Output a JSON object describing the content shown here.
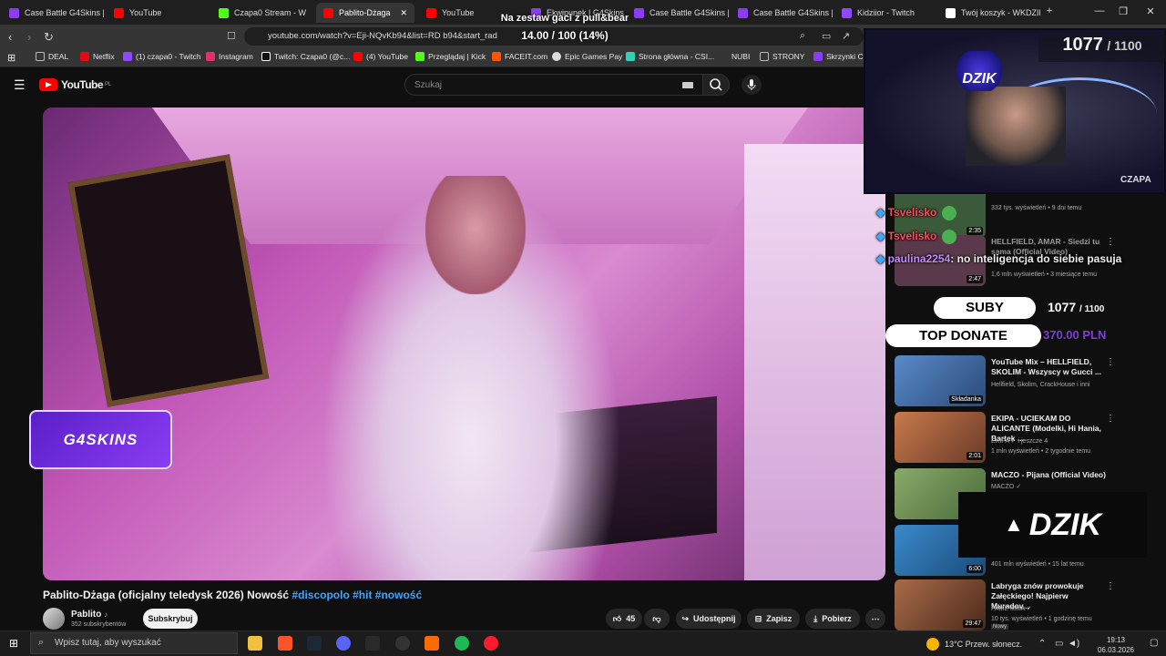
{
  "tabs": [
    {
      "label": "Case Battle G4Skins | 2",
      "color": "#8a3df2"
    },
    {
      "label": "YouTube",
      "color": "#ff0000"
    },
    {
      "label": "Czapa0 Stream - W",
      "color": "#53fc18"
    },
    {
      "label": "Pablito-Dżaga",
      "color": "#ff0000",
      "active": true
    },
    {
      "label": "YouTube",
      "color": "#ff0000"
    },
    {
      "label": "Ekwipunek | G4Skins",
      "color": "#8a3df2"
    },
    {
      "label": "Case Battle G4Skins | 2",
      "color": "#8a3df2"
    },
    {
      "label": "Case Battle G4Skins | 2",
      "color": "#8a3df2"
    },
    {
      "label": "Kidziior - Twitch",
      "color": "#9146ff"
    },
    {
      "label": "Twój koszyk - WKDZIK",
      "color": "#ffffff"
    }
  ],
  "address": {
    "url": "youtube.com/watch?v=Eji-NQvKb94&list=RD          b94&start_rad"
  },
  "bookmarks": [
    {
      "label": "DEAL",
      "color": "#bbbbbb"
    },
    {
      "label": "Netflix",
      "color": "#e50914"
    },
    {
      "label": "(1) czapa0 - Twitch",
      "color": "#9146ff"
    },
    {
      "label": "Instagram",
      "color": "#e1306c"
    },
    {
      "label": "Twitch: Czapa0 (@c...",
      "color": "#ffffff"
    },
    {
      "label": "(4) YouTube",
      "color": "#ff0000"
    },
    {
      "label": "Przeglądaj | Kick",
      "color": "#53fc18"
    },
    {
      "label": "FACEIT.com",
      "color": "#ff5500"
    },
    {
      "label": "Epic Games Pay",
      "color": "#dddddd"
    },
    {
      "label": "Strona główna - CSI...",
      "color": "#2ed3b7"
    },
    {
      "label": "NUBI",
      "color": "#888888"
    },
    {
      "label": "STRONY",
      "color": "#bbbbbb"
    },
    {
      "label": "Skrzynki CSs",
      "color": "#8a3df2"
    }
  ],
  "youtube": {
    "logo_text": "YouTube",
    "region": "PL",
    "search_placeholder": "Szukaj",
    "video_title": "Pablito-Dżaga (oficjalny teledysk 2026) Nowość",
    "video_tags": "#discopolo #hit #nowość",
    "channel_name": "Pablito",
    "channel_subs": "352 subskrybentów",
    "subscribe_label": "Subskrybuj",
    "likes": "45",
    "share_label": "Udostępnij",
    "save_label": "Zapisz",
    "download_label": "Pobierz"
  },
  "recommendations": [
    {
      "title": "",
      "meta1": "332 tys. wyświetleń • 9 dni temu",
      "meta2": "",
      "duration": "2:35",
      "color": "#3a5a3a"
    },
    {
      "title": "HELLFIELD, AMAR - Siedzi tu sama (Official Video)",
      "meta1": "1,6 mln wyświetleń • 3 miesiące temu",
      "meta2": "",
      "duration": "2:47",
      "color": "#5a3a4a"
    },
    {
      "title": "YouTube Mix – HELLFIELD, SKOLIM - Wszyscy w Gucci ...",
      "meta1": "Hellfield, Skolim, CrackHouse i inni",
      "meta2": "",
      "duration": "Składanka",
      "color": "#4a7ab0"
    },
    {
      "title": "EKIPA - UCIEKAM DO ALICANTE (Modelki, Hi Hania, Bartek ...",
      "meta1": "EKIPA ✓ i jeszcze 4",
      "meta2": "1 mln wyświetleń • 2 tygodnie temu",
      "duration": "2:01",
      "color": "#b05a3a"
    },
    {
      "title": "MACZO - Pijana (Official Video)",
      "meta1": "MACZO ✓",
      "meta2": "",
      "duration": "",
      "color": "#6a8a5a"
    },
    {
      "title": "",
      "meta1": "401 mln wyświetleń • 15 lat temu",
      "meta2": "",
      "duration": "6:00",
      "color": "#2a6a9a"
    },
    {
      "title": "Labryga znów prowokuje Załęckiego! Najpierw Muradov...",
      "meta1": "FAME MMA ✓",
      "meta2": "10 tys. wyświetleń • 1 godzinę temu",
      "duration": "29:47",
      "color": "#7a4a3a",
      "badge": "Nowy"
    }
  ],
  "stream_overlay": {
    "goal_text": "Na zestaw gaci z pull&bear",
    "goal_progress": "14.00 / 100 (14%)",
    "cam_count": "1077",
    "cam_target": "/ 1100",
    "cam_name": "CZAPA",
    "cam_badge": "DZIK",
    "chat": [
      {
        "user": "Tsvelisko",
        "msg": ""
      },
      {
        "user": "Tsvelisko",
        "msg": ""
      },
      {
        "user": "paulina2254",
        "msg": "no inteligencja do siebie pasuja"
      }
    ],
    "subs_label": "SUBY",
    "subs_count": "1077",
    "subs_target": "/ 1100",
    "top_donate_label": "TOP DONATE",
    "top_donate_value": "370.00 PLN",
    "g4_text": "G4SKINS",
    "dzik_logo": "DZIK"
  },
  "taskbar": {
    "search_placeholder": "Wpisz tutaj, aby wyszukać",
    "weather": "13°C  Przew. słonecz.",
    "time": "19:13",
    "date": "06.03.2026"
  }
}
